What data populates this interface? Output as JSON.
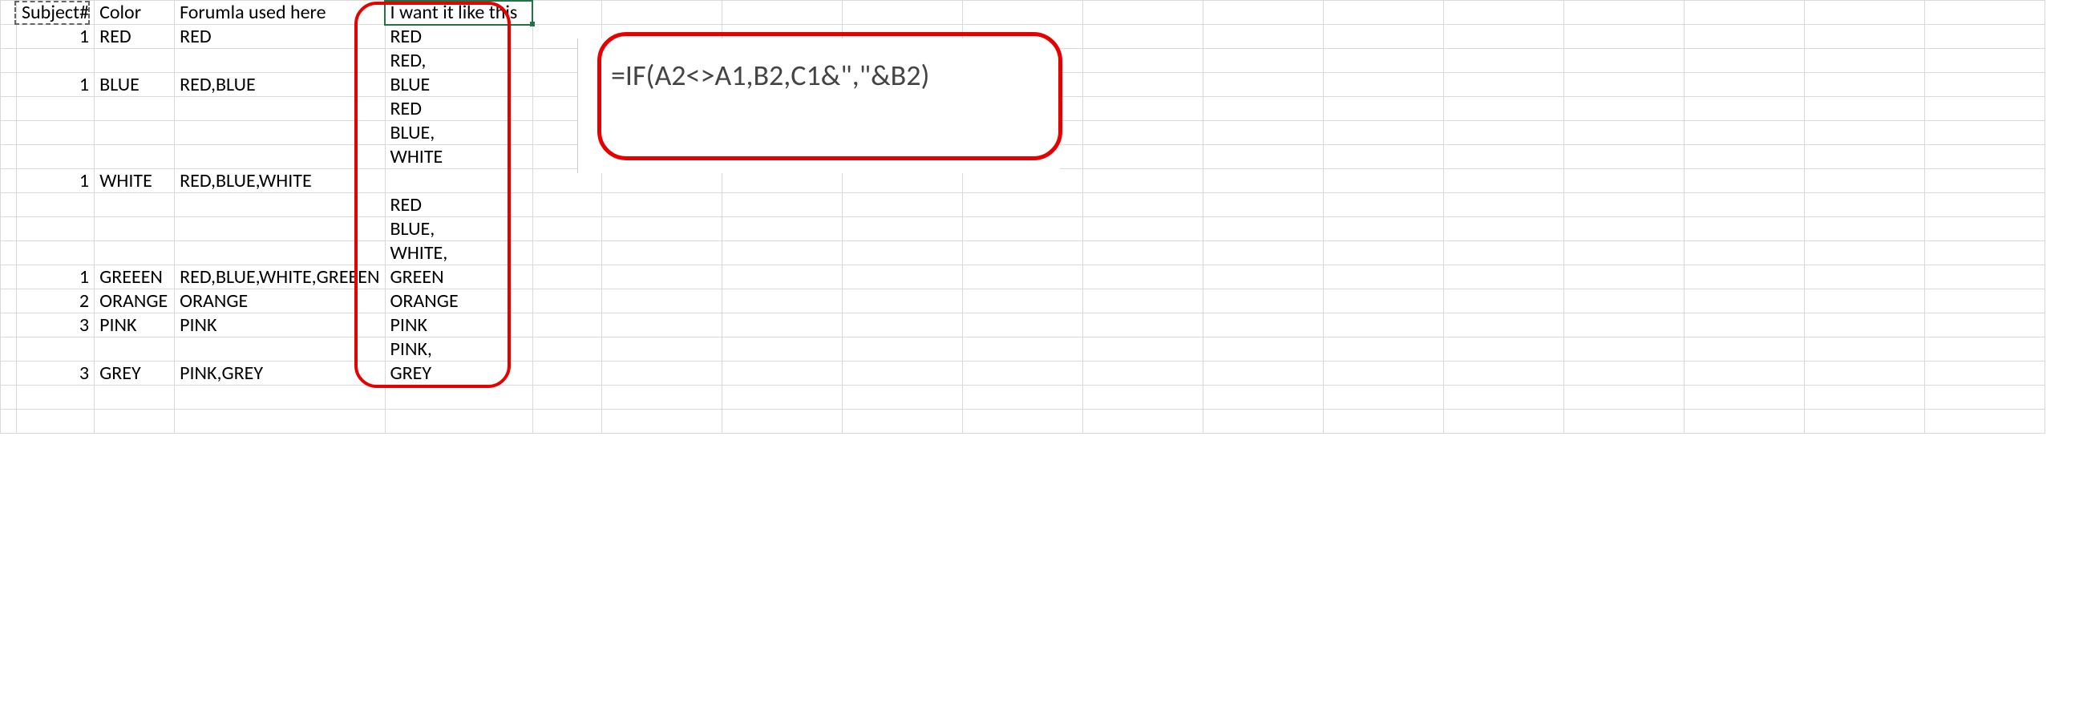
{
  "headers": {
    "a": "Subject#",
    "b": "Color",
    "c": "Forumla used here",
    "d": "I want it like this"
  },
  "rows": [
    {
      "a": "1",
      "b": "RED",
      "c": "RED",
      "d": "RED"
    },
    {
      "a": "",
      "b": "",
      "c": "",
      "d": "RED,"
    },
    {
      "a": "1",
      "b": "BLUE",
      "c": "RED,BLUE",
      "d": "BLUE"
    },
    {
      "a": "",
      "b": "",
      "c": "",
      "d": "RED"
    },
    {
      "a": "",
      "b": "",
      "c": "",
      "d": "BLUE,"
    },
    {
      "a": "",
      "b": "",
      "c": "",
      "d": "WHITE"
    },
    {
      "a": "1",
      "b": "WHITE",
      "c": "RED,BLUE,WHITE",
      "d": ""
    },
    {
      "a": "",
      "b": "",
      "c": "",
      "d": "RED"
    },
    {
      "a": "",
      "b": "",
      "c": "",
      "d": "BLUE,"
    },
    {
      "a": "",
      "b": "",
      "c": "",
      "d": "WHITE,"
    },
    {
      "a": "1",
      "b": "GREEEN",
      "c": "RED,BLUE,WHITE,GREEEN",
      "d": "GREEN"
    },
    {
      "a": "2",
      "b": "ORANGE",
      "c": "ORANGE",
      "d": "ORANGE"
    },
    {
      "a": "3",
      "b": "PINK",
      "c": "PINK",
      "d": "PINK"
    },
    {
      "a": "",
      "b": "",
      "c": "",
      "d": "PINK,"
    },
    {
      "a": "3",
      "b": "GREY",
      "c": "PINK,GREY",
      "d": "GREY"
    },
    {
      "a": "",
      "b": "",
      "c": "",
      "d": ""
    },
    {
      "a": "",
      "b": "",
      "c": "",
      "d": ""
    }
  ],
  "formula": "=IF(A2<>A1,B2,C1&\",\"&B2)",
  "selected_cell_content": "I want it like this"
}
